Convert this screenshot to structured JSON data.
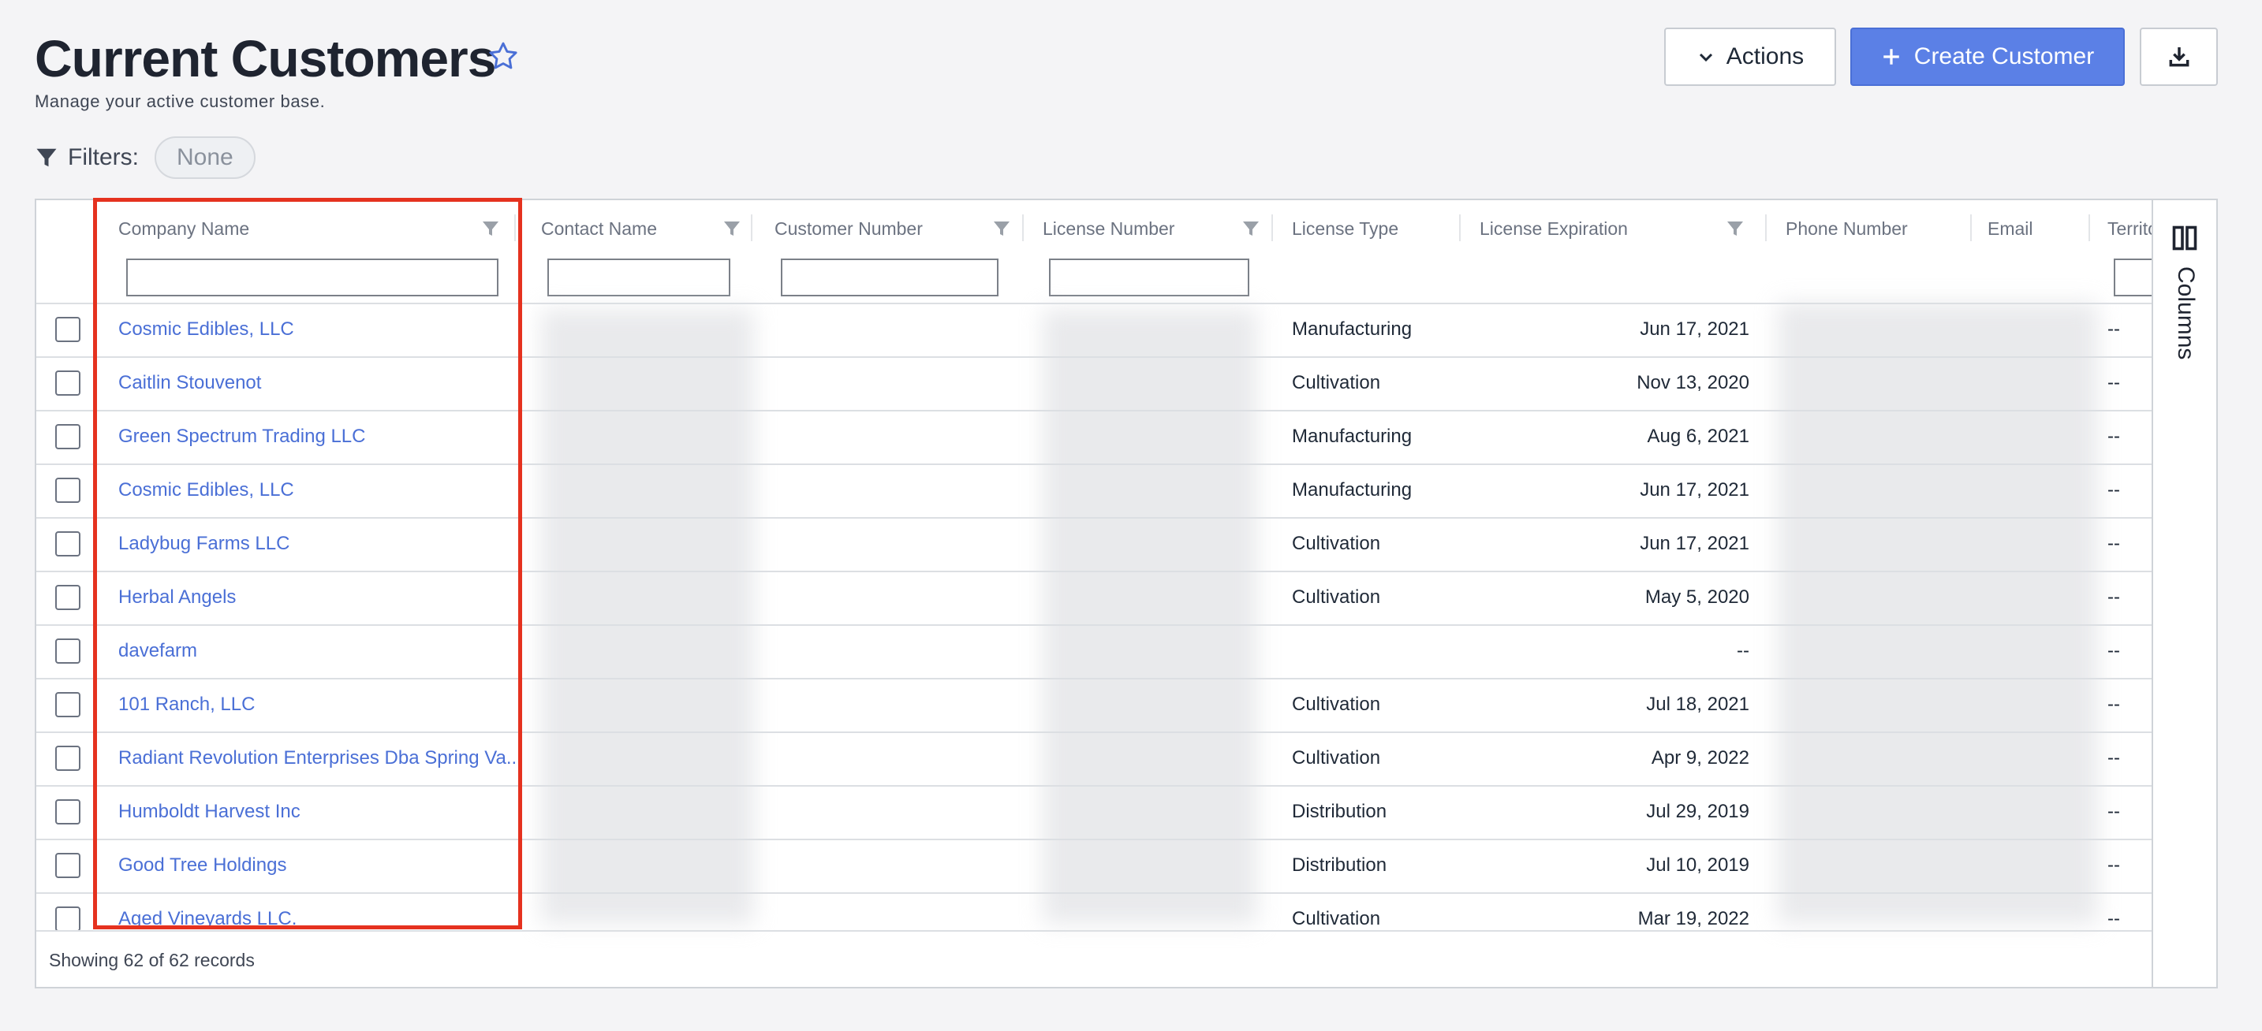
{
  "header": {
    "title": "Current Customers",
    "subtitle": "Manage your active customer base.",
    "actions_label": "Actions",
    "create_label": "Create Customer"
  },
  "filters": {
    "label": "Filters:",
    "value": "None"
  },
  "columns": [
    "Company Name",
    "Contact Name",
    "Customer Number",
    "License Number",
    "License Type",
    "License Expiration",
    "Phone Number",
    "Email",
    "Territory"
  ],
  "rows": [
    {
      "company": "Cosmic Edibles, LLC",
      "license_type": "Manufacturing",
      "expiration": "Jun 17, 2021",
      "territory": "--"
    },
    {
      "company": "Caitlin Stouvenot",
      "license_type": "Cultivation",
      "expiration": "Nov 13, 2020",
      "territory": "--"
    },
    {
      "company": "Green Spectrum Trading LLC",
      "license_type": "Manufacturing",
      "expiration": "Aug 6, 2021",
      "territory": "--"
    },
    {
      "company": "Cosmic Edibles, LLC",
      "license_type": "Manufacturing",
      "expiration": "Jun 17, 2021",
      "territory": "--"
    },
    {
      "company": "Ladybug Farms LLC",
      "license_type": "Cultivation",
      "expiration": "Jun 17, 2021",
      "territory": "--"
    },
    {
      "company": "Herbal Angels",
      "license_type": "Cultivation",
      "expiration": "May 5, 2020",
      "territory": "--"
    },
    {
      "company": "davefarm",
      "license_type": "",
      "expiration": "--",
      "territory": "--"
    },
    {
      "company": "101 Ranch, LLC",
      "license_type": "Cultivation",
      "expiration": "Jul 18, 2021",
      "territory": "--"
    },
    {
      "company": "Radiant Revolution Enterprises Dba Spring Va...",
      "license_type": "Cultivation",
      "expiration": "Apr 9, 2022",
      "territory": "--"
    },
    {
      "company": "Humboldt Harvest Inc",
      "license_type": "Distribution",
      "expiration": "Jul 29, 2019",
      "territory": "--"
    },
    {
      "company": "Good Tree Holdings",
      "license_type": "Distribution",
      "expiration": "Jul 10, 2019",
      "territory": "--"
    },
    {
      "company": "Aged Vineyards LLC.",
      "license_type": "Cultivation",
      "expiration": "Mar 19, 2022",
      "territory": "--"
    }
  ],
  "side_panel": {
    "label": "Columns"
  },
  "footer": {
    "status": "Showing 62 of 62 records"
  },
  "colors": {
    "accent": "#5b80e6",
    "link": "#4a6fd6",
    "highlight": "#e5321f"
  }
}
